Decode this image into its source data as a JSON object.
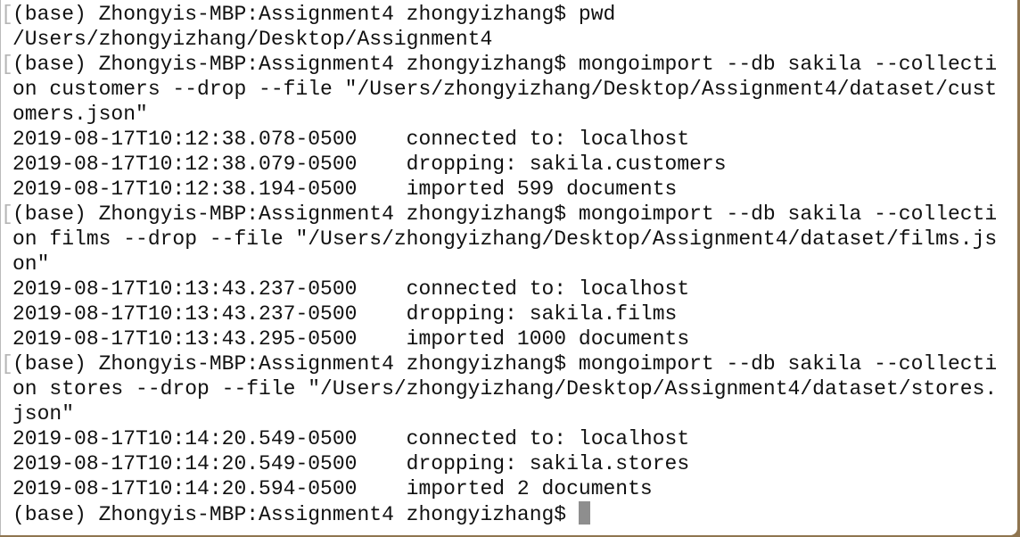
{
  "terminal": {
    "lines": [
      {
        "text": "(base) Zhongyis-MBP:Assignment4 zhongyizhang$ pwd",
        "marked": true
      },
      {
        "text": "/Users/zhongyizhang/Desktop/Assignment4",
        "marked": false
      },
      {
        "text": "(base) Zhongyis-MBP:Assignment4 zhongyizhang$ mongoimport --db sakila --collecti",
        "marked": true
      },
      {
        "text": "on customers --drop --file \"/Users/zhongyizhang/Desktop/Assignment4/dataset/cust",
        "marked": false
      },
      {
        "text": "omers.json\"",
        "marked": false
      },
      {
        "text": "2019-08-17T10:12:38.078-0500    connected to: localhost",
        "marked": false
      },
      {
        "text": "2019-08-17T10:12:38.079-0500    dropping: sakila.customers",
        "marked": false
      },
      {
        "text": "2019-08-17T10:12:38.194-0500    imported 599 documents",
        "marked": false
      },
      {
        "text": "(base) Zhongyis-MBP:Assignment4 zhongyizhang$ mongoimport --db sakila --collecti",
        "marked": true
      },
      {
        "text": "on films --drop --file \"/Users/zhongyizhang/Desktop/Assignment4/dataset/films.js",
        "marked": false
      },
      {
        "text": "on\"",
        "marked": false
      },
      {
        "text": "2019-08-17T10:13:43.237-0500    connected to: localhost",
        "marked": false
      },
      {
        "text": "2019-08-17T10:13:43.237-0500    dropping: sakila.films",
        "marked": false
      },
      {
        "text": "2019-08-17T10:13:43.295-0500    imported 1000 documents",
        "marked": false
      },
      {
        "text": "(base) Zhongyis-MBP:Assignment4 zhongyizhang$ mongoimport --db sakila --collecti",
        "marked": true
      },
      {
        "text": "on stores --drop --file \"/Users/zhongyizhang/Desktop/Assignment4/dataset/stores.",
        "marked": false
      },
      {
        "text": "json\"",
        "marked": false
      },
      {
        "text": "2019-08-17T10:14:20.549-0500    connected to: localhost",
        "marked": false
      },
      {
        "text": "2019-08-17T10:14:20.549-0500    dropping: sakila.stores",
        "marked": false
      },
      {
        "text": "2019-08-17T10:14:20.594-0500    imported 2 documents",
        "marked": false
      }
    ],
    "prompt": "(base) Zhongyis-MBP:Assignment4 zhongyizhang$",
    "mark_left": "[",
    "mark_right": "]"
  }
}
